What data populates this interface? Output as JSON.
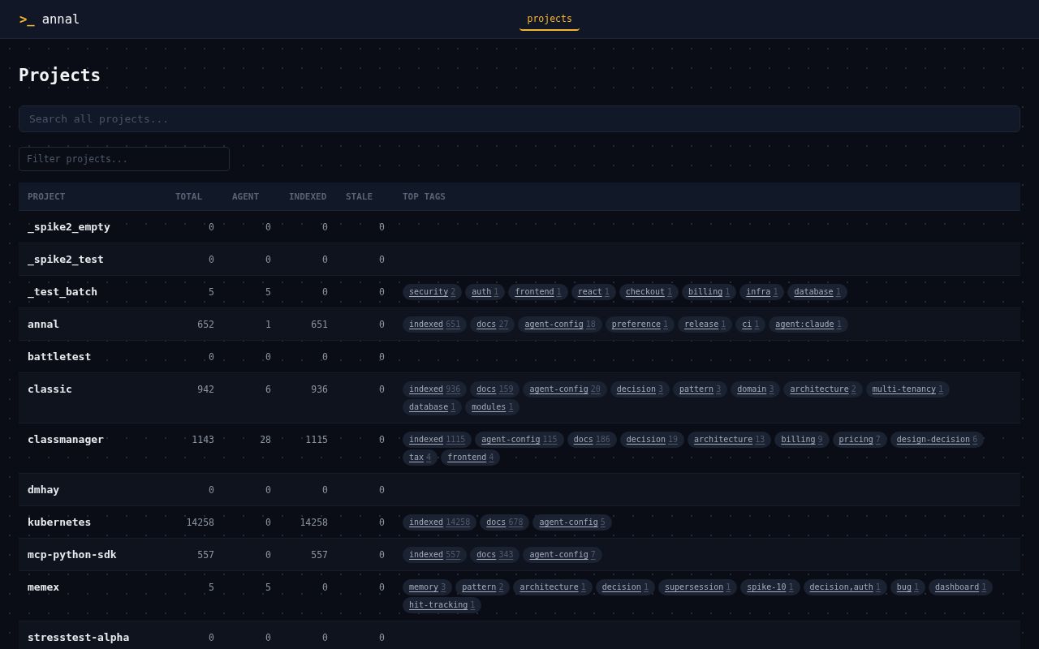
{
  "header": {
    "logo": {
      "prompt": ">_",
      "name": "annal"
    },
    "nav": [
      {
        "label": "projects",
        "selected": true
      }
    ]
  },
  "page": {
    "title": "Projects"
  },
  "search": {
    "placeholder": "Search all projects..."
  },
  "filter": {
    "placeholder": "Filter projects..."
  },
  "table": {
    "columns": [
      "PROJECT",
      "TOTAL",
      "AGENT",
      "INDEXED",
      "STALE",
      "TOP TAGS"
    ],
    "rows": [
      {
        "project": "_spike2_empty",
        "total": "0",
        "agent": "0",
        "indexed": "0",
        "stale": "0"
      },
      {
        "project": "_spike2_test",
        "total": "0",
        "agent": "0",
        "indexed": "0",
        "stale": "0"
      },
      {
        "project": "_test_batch",
        "total": "5",
        "agent": "5",
        "indexed": "0",
        "stale": "0",
        "tags": [
          {
            "name": "security",
            "count": "2"
          },
          {
            "name": "auth",
            "count": "1"
          },
          {
            "name": "frontend",
            "count": "1"
          },
          {
            "name": "react",
            "count": "1"
          },
          {
            "name": "checkout",
            "count": "1"
          },
          {
            "name": "billing",
            "count": "1"
          },
          {
            "name": "infra",
            "count": "1"
          },
          {
            "name": "database",
            "count": "1"
          }
        ]
      },
      {
        "project": "annal",
        "total": "652",
        "agent": "1",
        "indexed": "651",
        "stale": "0",
        "tags": [
          {
            "name": "indexed",
            "count": "651"
          },
          {
            "name": "docs",
            "count": "27"
          },
          {
            "name": "agent-config",
            "count": "18"
          },
          {
            "name": "preference",
            "count": "1"
          },
          {
            "name": "release",
            "count": "1"
          },
          {
            "name": "ci",
            "count": "1"
          },
          {
            "name": "agent:claude",
            "count": "1"
          }
        ]
      },
      {
        "project": "battletest",
        "total": "0",
        "agent": "0",
        "indexed": "0",
        "stale": "0"
      },
      {
        "project": "classic",
        "total": "942",
        "agent": "6",
        "indexed": "936",
        "stale": "0",
        "tags": [
          {
            "name": "indexed",
            "count": "936"
          },
          {
            "name": "docs",
            "count": "159"
          },
          {
            "name": "agent-config",
            "count": "20"
          },
          {
            "name": "decision",
            "count": "3"
          },
          {
            "name": "pattern",
            "count": "3"
          },
          {
            "name": "domain",
            "count": "3"
          },
          {
            "name": "architecture",
            "count": "2"
          },
          {
            "name": "multi-tenancy",
            "count": "1"
          },
          {
            "name": "database",
            "count": "1"
          },
          {
            "name": "modules",
            "count": "1"
          }
        ]
      },
      {
        "project": "classmanager",
        "total": "1143",
        "agent": "28",
        "indexed": "1115",
        "stale": "0",
        "tags": [
          {
            "name": "indexed",
            "count": "1115"
          },
          {
            "name": "agent-config",
            "count": "115"
          },
          {
            "name": "docs",
            "count": "186"
          },
          {
            "name": "decision",
            "count": "19"
          },
          {
            "name": "architecture",
            "count": "13"
          },
          {
            "name": "billing",
            "count": "9"
          },
          {
            "name": "pricing",
            "count": "7"
          },
          {
            "name": "design-decision",
            "count": "6"
          },
          {
            "name": "tax",
            "count": "4"
          },
          {
            "name": "frontend",
            "count": "4"
          }
        ]
      },
      {
        "project": "dmhay",
        "total": "0",
        "agent": "0",
        "indexed": "0",
        "stale": "0"
      },
      {
        "project": "kubernetes",
        "total": "14258",
        "agent": "0",
        "indexed": "14258",
        "stale": "0",
        "tags": [
          {
            "name": "indexed",
            "count": "14258"
          },
          {
            "name": "docs",
            "count": "678"
          },
          {
            "name": "agent-config",
            "count": "5"
          }
        ]
      },
      {
        "project": "mcp-python-sdk",
        "total": "557",
        "agent": "0",
        "indexed": "557",
        "stale": "0",
        "tags": [
          {
            "name": "indexed",
            "count": "557"
          },
          {
            "name": "docs",
            "count": "343"
          },
          {
            "name": "agent-config",
            "count": "7"
          }
        ]
      },
      {
        "project": "memex",
        "total": "5",
        "agent": "5",
        "indexed": "0",
        "stale": "0",
        "tags": [
          {
            "name": "memory",
            "count": "3"
          },
          {
            "name": "pattern",
            "count": "2"
          },
          {
            "name": "architecture",
            "count": "1"
          },
          {
            "name": "decision",
            "count": "1"
          },
          {
            "name": "supersession",
            "count": "1"
          },
          {
            "name": "spike-10",
            "count": "1"
          },
          {
            "name": "decision,auth",
            "count": "1"
          },
          {
            "name": "bug",
            "count": "1"
          },
          {
            "name": "dashboard",
            "count": "1"
          },
          {
            "name": "hit-tracking",
            "count": "1"
          }
        ]
      },
      {
        "project": "stresstest-alpha",
        "total": "0",
        "agent": "0",
        "indexed": "0",
        "stale": "0"
      }
    ]
  }
}
